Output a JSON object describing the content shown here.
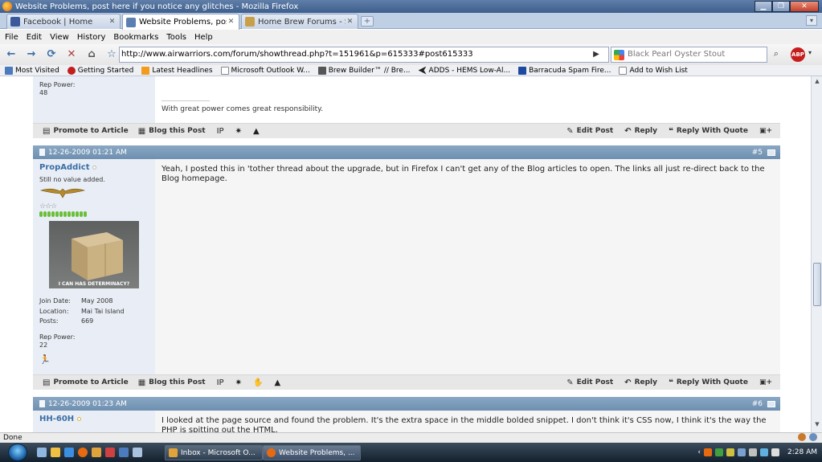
{
  "window": {
    "title": "Website Problems, post here if you notice any glitches - Mozilla Firefox",
    "minimize": "▁",
    "maximize": "❐",
    "close": "✕"
  },
  "tabs": [
    {
      "label": "Facebook | Home",
      "color": "#3b5998",
      "active": false
    },
    {
      "label": "Website Problems, post ...",
      "color": "#5a7fb0",
      "active": true
    },
    {
      "label": "Home Brew Forums - S...",
      "color": "#c9a049",
      "active": false
    }
  ],
  "tab_close": "✕",
  "new_tab": "+",
  "list_all_tabs": "▾",
  "menu": [
    "File",
    "Edit",
    "View",
    "History",
    "Bookmarks",
    "Tools",
    "Help"
  ],
  "nav": {
    "back": "←",
    "forward": "→",
    "reload": "⟳",
    "stop": "✕",
    "home": "⌂",
    "bookmark": "☆",
    "go": "▶",
    "url": "http://www.airwarriors.com/forum/showthread.php?t=151961&p=615333#post615333",
    "search_value": "Black Pearl Oyster Stout",
    "search_icon": "⌕",
    "abp_label": "ABP",
    "dropdown": "▾"
  },
  "bookmarks": [
    {
      "label": "Most Visited",
      "color": "#4b7bbd"
    },
    {
      "label": "Getting Started",
      "color": "#c21e1e"
    },
    {
      "label": "Latest Headlines",
      "color": "#f29b1c"
    },
    {
      "label": "Microsoft Outlook W...",
      "color": "#ffffff"
    },
    {
      "label": "Brew Builder™ // Bre...",
      "color": "#555555"
    },
    {
      "label": "ADDS - HEMS Low-Al...",
      "color": "#222222"
    },
    {
      "label": "Barracuda Spam Fire...",
      "color": "#1d4aa0"
    },
    {
      "label": "Add to Wish List",
      "color": "#ffffff"
    }
  ],
  "previous_post": {
    "rep_label": "Rep Power:",
    "rep_value": "48",
    "signature": "With great power comes great responsibility."
  },
  "actions": {
    "promote": "Promote to Article",
    "blog": "Blog this Post",
    "edit": "Edit Post",
    "reply": "Reply",
    "reply_quote": "Reply With Quote",
    "ip_label": "IP"
  },
  "posts": [
    {
      "date": "12-26-2009 01:21 AM",
      "number": "#5",
      "username": "PropAddict",
      "user_title": "Still no value added.",
      "avatar_caption": "I CAN HAS DETERMINACY?",
      "join_date_label": "Join Date:",
      "join_date": "May 2008",
      "location_label": "Location:",
      "location": "Mai Tai Island",
      "posts_label": "Posts:",
      "posts": "669",
      "rep_label": "Rep Power:",
      "rep_value": "22",
      "body": "Yeah, I posted this in 'tother thread about the upgrade, but in Firefox I can't get any of the Blog articles to open. The links all just re-direct back to the Blog homepage."
    },
    {
      "date": "12-26-2009 01:23 AM",
      "number": "#6",
      "username": "HH-60H",
      "body": "I looked at the page source and found the problem. It's the extra space in the middle bolded snippet. I don't think it's CSS now, I think it's the way the PHP is spitting out the HTML."
    }
  ],
  "status": {
    "text": "Done"
  },
  "taskbar": {
    "tasks": [
      {
        "label": "Inbox - Microsoft O...",
        "color": "#e0a23a"
      },
      {
        "label": "Website Problems, ...",
        "color": "#e86a10"
      }
    ],
    "clock": "2:28 AM",
    "tray_arrow": "‹"
  }
}
